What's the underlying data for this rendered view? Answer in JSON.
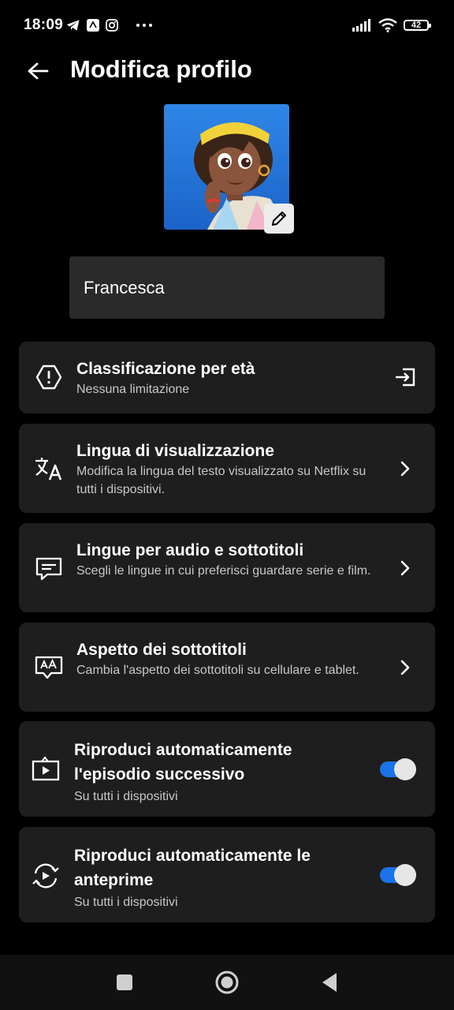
{
  "status_bar": {
    "time": "18:09",
    "battery": "42",
    "icons_left": [
      "telegram-icon",
      "app-icon",
      "instagram-icon",
      "more-icon"
    ],
    "icons_right": [
      "signal-icon",
      "wifi-icon",
      "battery-icon"
    ]
  },
  "header": {
    "title": "Modifica profilo"
  },
  "profile": {
    "name": "Francesca"
  },
  "settings": [
    {
      "title": "Classificazione per età",
      "description": "Nessuna limitazione",
      "icon": "warning-octagon-icon",
      "trailing": "open-external-icon"
    },
    {
      "title": "Lingua di visualizzazione",
      "description": "Modifica la lingua del testo visualizzato su Netflix su tutti i dispositivi.",
      "icon": "translate-icon",
      "trailing": "chevron-right-icon"
    },
    {
      "title": "Lingue per audio e sottotitoli",
      "description": "Scegli le lingue in cui preferisci guardare serie e film.",
      "icon": "subtitles-icon",
      "trailing": "chevron-right-icon"
    },
    {
      "title": "Aspetto dei sottotitoli",
      "description": "Cambia l'aspetto dei sottotitoli su cellulare e tablet.",
      "icon": "caption-style-icon",
      "trailing": "chevron-right-icon"
    },
    {
      "title": "Riproduci automaticamente l'episodio successivo",
      "description": "Su tutti i dispositivi",
      "icon": "next-episode-icon",
      "toggle_on": true
    },
    {
      "title": "Riproduci automaticamente le anteprime",
      "description": "Su tutti i dispositivi",
      "icon": "autoplay-previews-icon",
      "toggle_on": true
    }
  ],
  "colors": {
    "background": "#000000",
    "card": "#1e1e1e",
    "field": "#2a2a2a",
    "toggle_accent": "#1a73e8"
  },
  "nav_bar": {
    "buttons": [
      "recents-square-icon",
      "home-circle-icon",
      "back-triangle-icon"
    ]
  }
}
